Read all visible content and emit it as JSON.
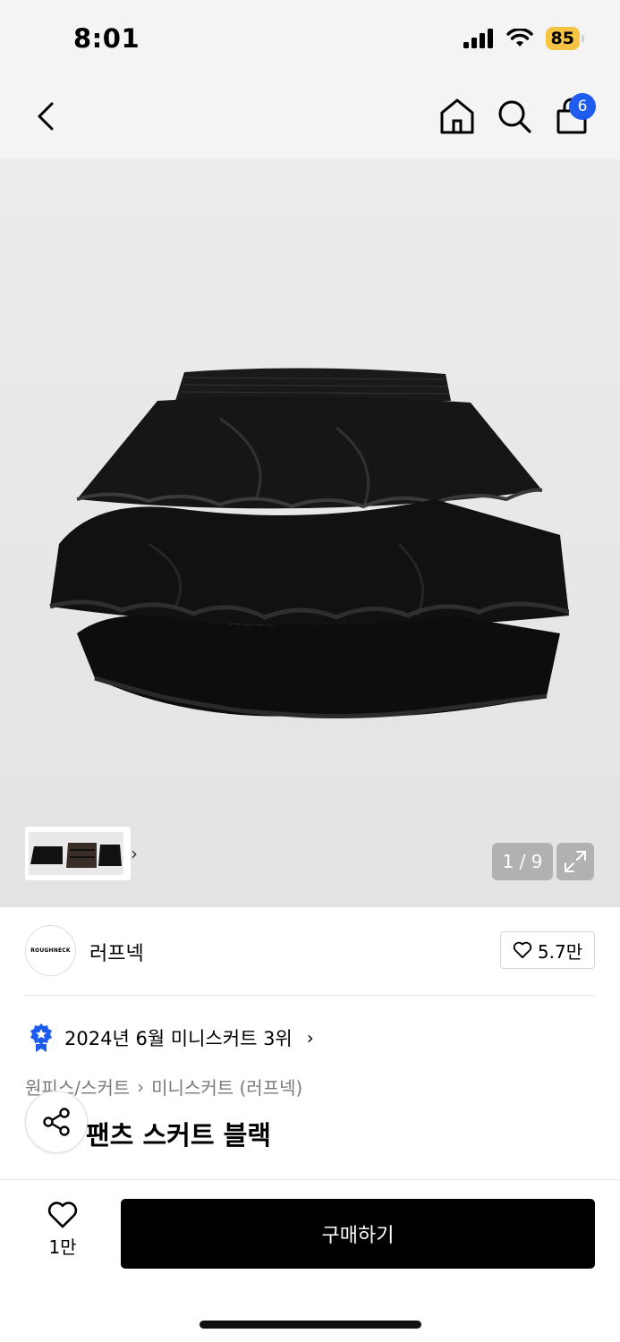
{
  "status_bar": {
    "time": "8:01",
    "battery": "85"
  },
  "nav": {
    "cart_count": "6"
  },
  "gallery": {
    "page_indicator": "1 / 9",
    "thumbnail_more": "›"
  },
  "brand": {
    "logo_text": "ROUGHNECK",
    "name": "러프넥",
    "likes": "5.7만"
  },
  "ranking": {
    "text": "2024년 6월 미니스커트 3위",
    "chevron": "›"
  },
  "breadcrumb": {
    "category": "원피스/스커트",
    "separator": "›",
    "subcategory": "미니스커트 (러프넥)"
  },
  "product": {
    "title_visible": "팬츠 스커트 블랙"
  },
  "bottom_bar": {
    "wish_count": "1만",
    "buy_label": "구매하기"
  },
  "colors": {
    "badge_blue": "#1e5cf0",
    "battery_yellow": "#f6c443",
    "buy_black": "#000000"
  }
}
